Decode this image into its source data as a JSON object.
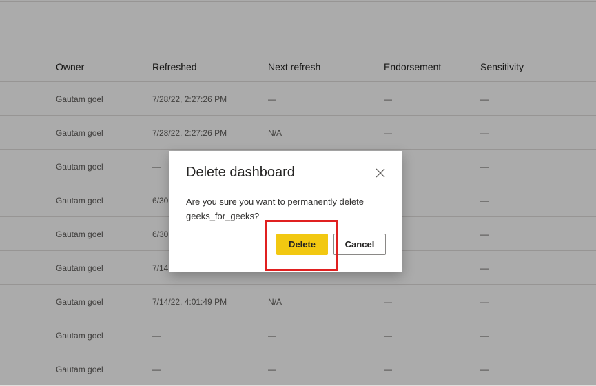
{
  "table": {
    "columns": [
      "Owner",
      "Refreshed",
      "Next refresh",
      "Endorsement",
      "Sensitivity"
    ],
    "rows": [
      {
        "owner": "Gautam goel",
        "refreshed": "7/28/22, 2:27:26 PM",
        "next_refresh": "—",
        "endorsement": "—",
        "sensitivity": "—"
      },
      {
        "owner": "Gautam goel",
        "refreshed": "7/28/22, 2:27:26 PM",
        "next_refresh": "N/A",
        "endorsement": "—",
        "sensitivity": "—"
      },
      {
        "owner": "Gautam goel",
        "refreshed": "—",
        "next_refresh": "",
        "endorsement": "",
        "sensitivity": "—"
      },
      {
        "owner": "Gautam goel",
        "refreshed": "6/30",
        "next_refresh": "",
        "endorsement": "",
        "sensitivity": "—"
      },
      {
        "owner": "Gautam goel",
        "refreshed": "6/30",
        "next_refresh": "",
        "endorsement": "",
        "sensitivity": "—"
      },
      {
        "owner": "Gautam goel",
        "refreshed": "7/14",
        "next_refresh": "",
        "endorsement": "",
        "sensitivity": "—"
      },
      {
        "owner": "Gautam goel",
        "refreshed": "7/14/22, 4:01:49 PM",
        "next_refresh": "N/A",
        "endorsement": "—",
        "sensitivity": "—"
      },
      {
        "owner": "Gautam goel",
        "refreshed": "—",
        "next_refresh": "—",
        "endorsement": "—",
        "sensitivity": "—"
      },
      {
        "owner": "Gautam goel",
        "refreshed": "—",
        "next_refresh": "—",
        "endorsement": "—",
        "sensitivity": "—"
      }
    ]
  },
  "dialog": {
    "title": "Delete dashboard",
    "message": "Are you sure you want to permanently delete geeks_for_geeks?",
    "delete_label": "Delete",
    "cancel_label": "Cancel",
    "close_icon": "close-icon"
  },
  "colors": {
    "primary_button": "#f2c811",
    "highlight": "#e02020",
    "overlay": "rgba(0,0,0,0.33)"
  }
}
